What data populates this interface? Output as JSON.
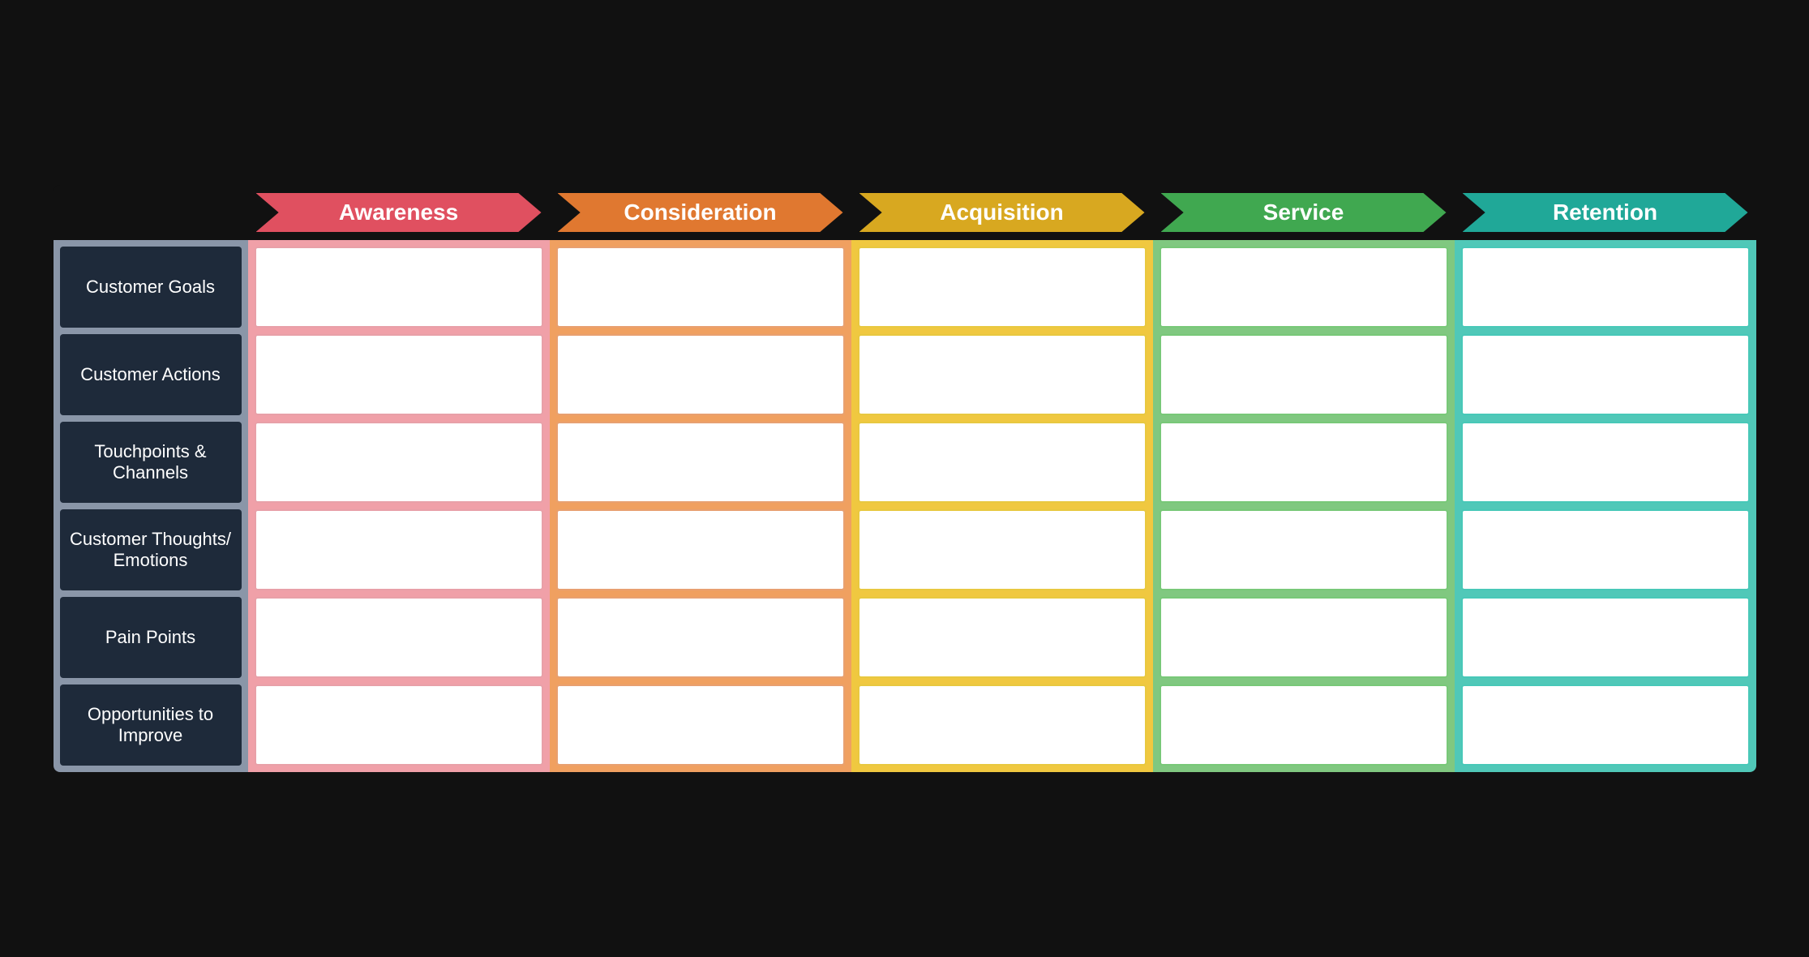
{
  "header": {
    "columns": [
      {
        "id": "awareness",
        "label": "Awareness",
        "colorClass": "awareness-arrow"
      },
      {
        "id": "consideration",
        "label": "Consideration",
        "colorClass": "consideration-arrow"
      },
      {
        "id": "acquisition",
        "label": "Acquisition",
        "colorClass": "acquisition-arrow"
      },
      {
        "id": "service",
        "label": "Service",
        "colorClass": "service-arrow"
      },
      {
        "id": "retention",
        "label": "Retention",
        "colorClass": "retention-arrow"
      }
    ]
  },
  "rows": [
    {
      "id": "customer-goals",
      "label": "Customer Goals"
    },
    {
      "id": "customer-actions",
      "label": "Customer Actions"
    },
    {
      "id": "touchpoints-channels",
      "label": "Touchpoints &\nChannels"
    },
    {
      "id": "customer-thoughts-emotions",
      "label": "Customer Thoughts/\nEmotions"
    },
    {
      "id": "pain-points",
      "label": "Pain Points"
    },
    {
      "id": "opportunities-to-improve",
      "label": "Opportunities to\nImprove"
    }
  ],
  "columnBgClasses": [
    "col-awareness",
    "col-consideration",
    "col-acquisition",
    "col-service",
    "col-retention"
  ]
}
